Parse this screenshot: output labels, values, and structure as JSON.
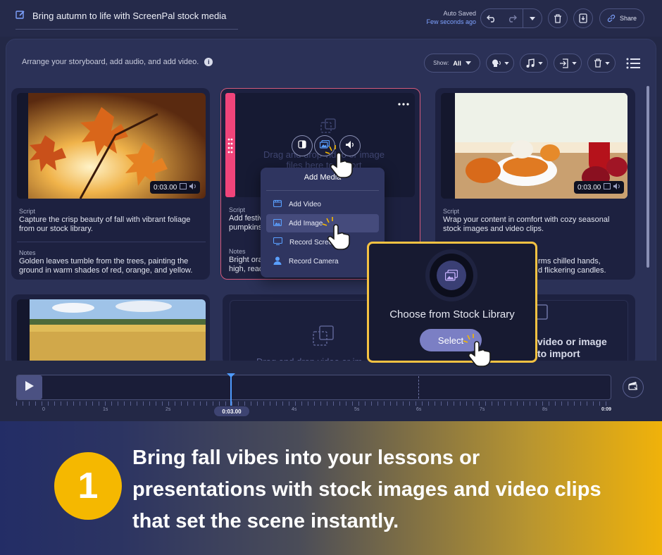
{
  "header": {
    "project_title": "Bring autumn to life with ScreenPal stock media",
    "autosave_label": "Auto Saved",
    "autosave_time": "Few seconds ago",
    "share_label": "Share"
  },
  "toolbar": {
    "arrange_text": "Arrange your storyboard, add audio, and add video.",
    "show_label": "Show:",
    "show_value": "All"
  },
  "cards": [
    {
      "duration": "0:03.00",
      "script_label": "Script",
      "script": "Capture the crisp beauty of fall with vibrant foliage from our stock library.",
      "notes_label": "Notes",
      "notes": "Golden leaves tumble from the trees, painting the ground in warm shades of red, orange, and yellow."
    },
    {
      "script_label": "Script",
      "script": "Add festiv",
      "script2": "pumpkins",
      "notes_label": "Notes",
      "notes": "Bright ora",
      "notes2": "high, read",
      "drop_text": "Drag and drop video or image",
      "drop_text2": "files here to import"
    },
    {
      "duration": "0:03.00",
      "script_label": "Script",
      "script": "Wrap your content in comfort with cozy seasonal stock images and video clips.",
      "notes_frag1": "rms chilled hands,",
      "notes_frag2": "d flickering candles."
    },
    {
      "drop_text": "Drag and drop video or im"
    },
    {
      "drop_text": "video or image",
      "drop_text2": "to import"
    }
  ],
  "add_media": {
    "title": "Add Media",
    "items": [
      "Add Video",
      "Add Image",
      "Record Screen",
      "Record Camera"
    ]
  },
  "stock_popup": {
    "title": "Choose from Stock Library",
    "button": "Select"
  },
  "timeline": {
    "current_time": "0:03.00",
    "ticks": [
      "0",
      "1s",
      "2s",
      "3s",
      "4s",
      "5s",
      "6s",
      "7s",
      "8s",
      "0:09"
    ]
  },
  "banner": {
    "step": "1",
    "text": "Bring fall vibes into your lessons or presentations with stock images and video clips that set the scene instantly."
  },
  "colors": {
    "accent_pink": "#f0447a",
    "highlight_yellow": "#f5c242",
    "badge_yellow": "#f5b800",
    "button_purple": "#7b7fc4"
  }
}
